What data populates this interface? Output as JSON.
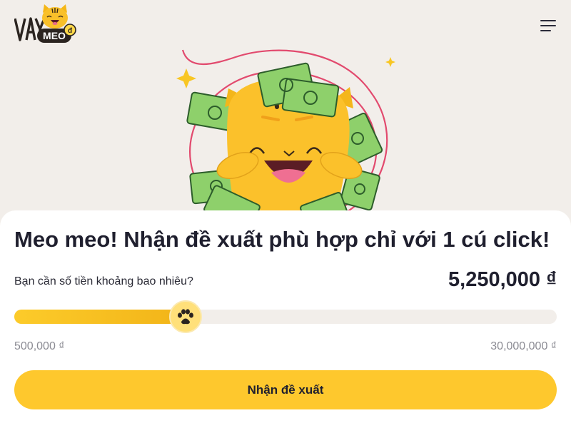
{
  "brand": {
    "logo_text_top": "VAY",
    "logo_text_badge": "MEO",
    "accent": "#fec82d"
  },
  "icons": {
    "menu": "hamburger-menu-icon",
    "slider_thumb": "paw-icon"
  },
  "hero": {
    "illustration": "smiling-yellow-cat-with-money-icon"
  },
  "headline": "Meo meo! Nhận đề xuất phù hợp chỉ với 1 cú click!",
  "loan": {
    "question": "Bạn cần số tiền khoảng bao nhiêu?",
    "amount_display": "5,250,000 ₫",
    "amount": 5250000,
    "min": 500000,
    "max": 30000000,
    "min_label": "500,000 ₫",
    "max_label": "30,000,000 ₫"
  },
  "cta_label": "Nhận đề xuất"
}
